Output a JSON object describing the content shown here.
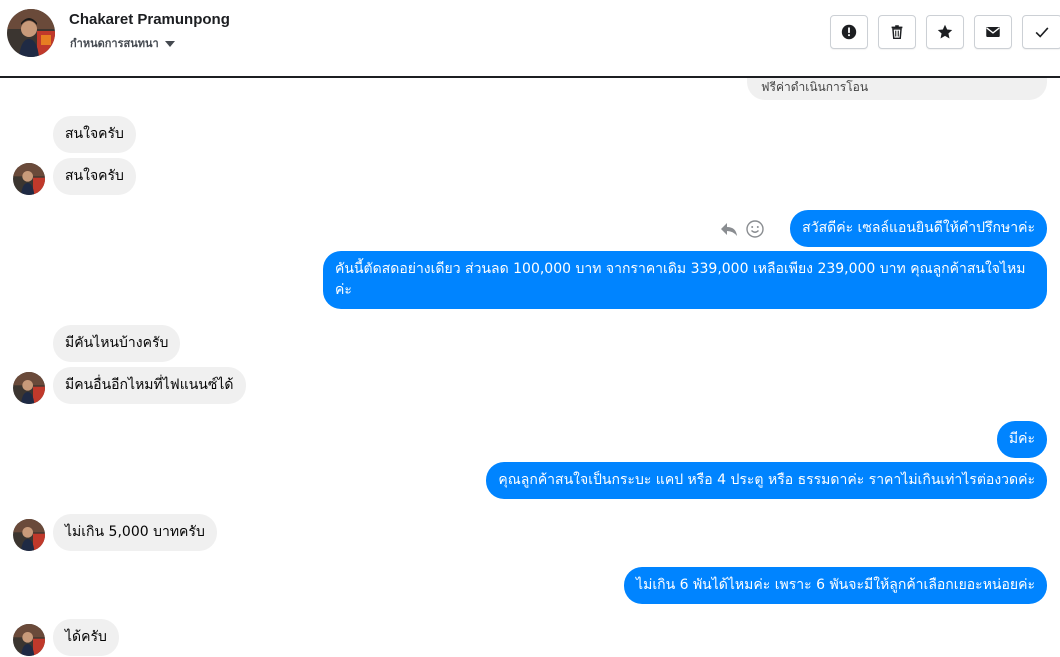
{
  "header": {
    "contact_name": "Chakaret Pramunpong",
    "subtitle": "กำหนดการสนทนา",
    "toolbar": [
      {
        "icon": "alert-icon",
        "label": "Mark as spam"
      },
      {
        "icon": "trash-icon",
        "label": "Delete"
      },
      {
        "icon": "star-icon",
        "label": "Star"
      },
      {
        "icon": "mail-icon",
        "label": "Mark as unread"
      },
      {
        "icon": "check-icon",
        "label": "Mark as done"
      }
    ]
  },
  "messages": [
    {
      "side": "out",
      "text": "ฟรีค่าดำเนินการโอน"
    },
    {
      "side": "in",
      "text": "สนใจครับ"
    },
    {
      "side": "in",
      "text": "สนใจครับ"
    },
    {
      "side": "out",
      "text": "สวัสดีค่ะ เซลล์แอนยินดีให้คำปรึกษาค่ะ"
    },
    {
      "side": "out",
      "text": "คันนี้ตัดสดอย่างเดียว ส่วนลด 100,000 บาท จากราคาเดิม 339,000 เหลือเพียง 239,000 บาท คุณลูกค้าสนใจไหมค่ะ"
    },
    {
      "side": "in",
      "text": "มีคันไหนบ้างครับ"
    },
    {
      "side": "in",
      "text": "มีคนอื่นอีกไหมที่ไฟแนนซ์ได้"
    },
    {
      "side": "out",
      "text": "มีค่ะ"
    },
    {
      "side": "out",
      "text": "คุณลูกค้าสนใจเป็นกระบะ แคป หรือ 4 ประตู หรือ ธรรมดาค่ะ ราคาไม่เกินเท่าไรต่องวดค่ะ"
    },
    {
      "side": "in",
      "text": "ไม่เกิน 5,000 บาทครับ"
    },
    {
      "side": "out",
      "text": "ไม่เกิน 6 พันได้ไหมค่ะ เพราะ 6 พันจะมีให้ลูกค้าเลือกเยอะหน่อยค่ะ"
    },
    {
      "side": "in",
      "text": "ได้ครับ"
    }
  ],
  "colors": {
    "outgoing_bubble": "#0084ff",
    "incoming_bubble": "#f0f0f0"
  }
}
